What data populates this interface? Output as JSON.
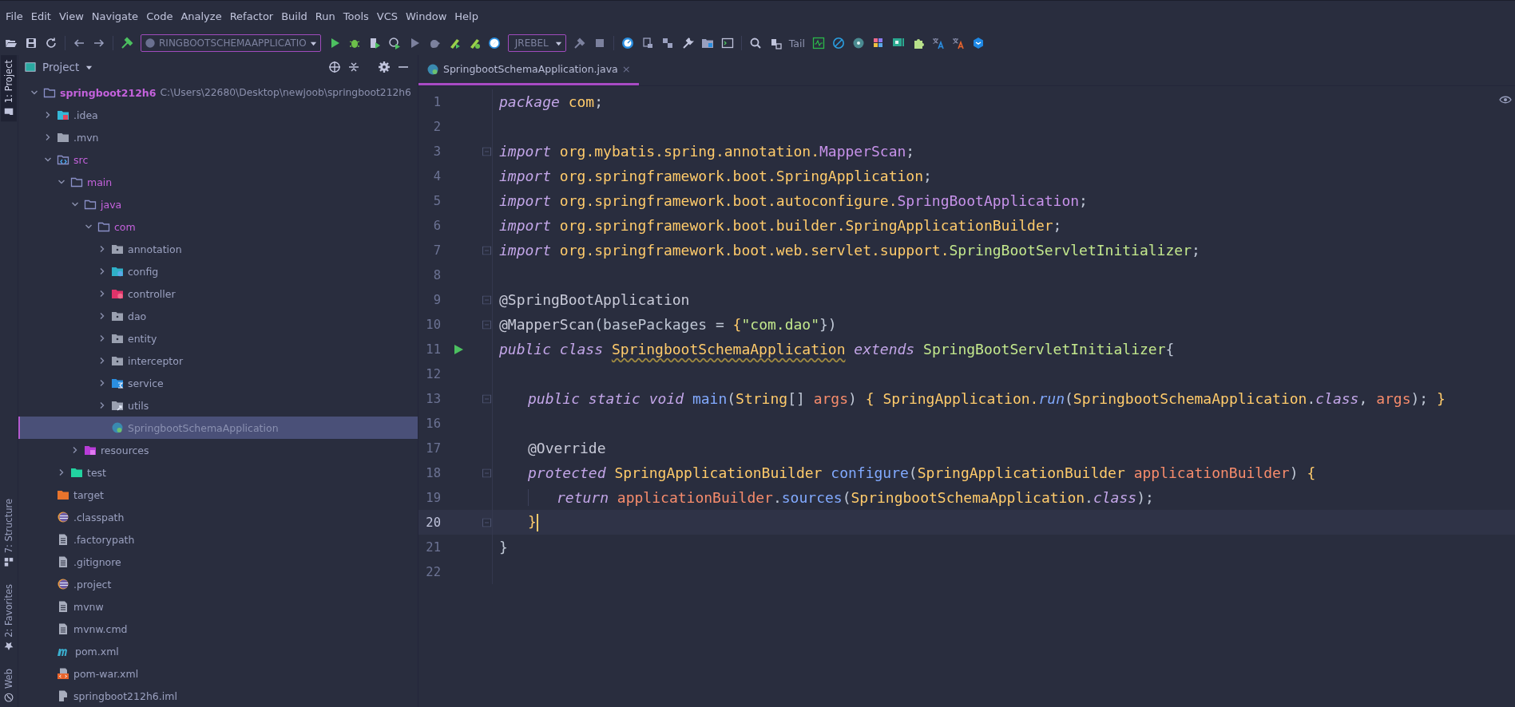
{
  "menu": [
    "File",
    "Edit",
    "View",
    "Navigate",
    "Code",
    "Analyze",
    "Refactor",
    "Build",
    "Run",
    "Tools",
    "VCS",
    "Window",
    "Help"
  ],
  "toolbar": {
    "run_config": "RINGBOOTSCHEMAAPPLICATIO",
    "jrebel": "JREBEL",
    "tail": "Tail"
  },
  "side_tabs_top": [
    {
      "label": "1: Project",
      "selected": true
    }
  ],
  "side_tabs_bottom": [
    {
      "label": "7: Structure",
      "selected": false
    },
    {
      "label": "2: Favorites",
      "selected": false
    },
    {
      "label": "Web",
      "selected": false
    }
  ],
  "project_panel": {
    "title": "Project",
    "tree": [
      {
        "name": "springboot212h6",
        "path": "C:\\Users\\22680\\Desktop\\newjoob\\springboot212h6",
        "kind": "module",
        "color": "#c462dc",
        "expanded": true,
        "selected": false,
        "children": [
          {
            "name": ".idea",
            "kind": "idea-folder",
            "color": "#9aa0bf",
            "expanded": false,
            "selected": false
          },
          {
            "name": ".mvn",
            "kind": "folder",
            "color": "#9aa0bf",
            "expanded": false,
            "selected": false
          },
          {
            "name": "src",
            "kind": "source-folder",
            "color": "#c462dc",
            "expanded": true,
            "selected": false,
            "children": [
              {
                "name": "main",
                "kind": "open-folder",
                "color": "#c462dc",
                "expanded": true,
                "selected": false,
                "children": [
                  {
                    "name": "java",
                    "kind": "open-folder",
                    "color": "#c462dc",
                    "expanded": true,
                    "selected": false,
                    "children": [
                      {
                        "name": "com",
                        "kind": "open-folder",
                        "color": "#c462dc",
                        "expanded": true,
                        "selected": false,
                        "children": [
                          {
                            "name": "annotation",
                            "kind": "package",
                            "color": "#9aa0bf",
                            "expanded": false,
                            "selected": false
                          },
                          {
                            "name": "config",
                            "kind": "config-package",
                            "color": "#9aa0bf",
                            "expanded": false,
                            "selected": false
                          },
                          {
                            "name": "controller",
                            "kind": "controller-package",
                            "color": "#9aa0bf",
                            "expanded": false,
                            "selected": false
                          },
                          {
                            "name": "dao",
                            "kind": "package",
                            "color": "#9aa0bf",
                            "expanded": false,
                            "selected": false
                          },
                          {
                            "name": "entity",
                            "kind": "package",
                            "color": "#9aa0bf",
                            "expanded": false,
                            "selected": false
                          },
                          {
                            "name": "interceptor",
                            "kind": "package",
                            "color": "#9aa0bf",
                            "expanded": false,
                            "selected": false
                          },
                          {
                            "name": "service",
                            "kind": "service-package",
                            "color": "#9aa0bf",
                            "expanded": false,
                            "selected": false
                          },
                          {
                            "name": "utils",
                            "kind": "utils-package",
                            "color": "#9aa0bf",
                            "expanded": false,
                            "selected": false
                          },
                          {
                            "name": "SpringbootSchemaApplication",
                            "kind": "spring-class",
                            "color": "#8a90b0",
                            "selected": true
                          }
                        ]
                      }
                    ]
                  },
                  {
                    "name": "resources",
                    "kind": "resources-folder",
                    "color": "#9aa0bf",
                    "expanded": false,
                    "selected": false
                  }
                ]
              },
              {
                "name": "test",
                "kind": "test-folder",
                "color": "#9aa0bf",
                "expanded": false,
                "selected": false
              }
            ]
          },
          {
            "name": "target",
            "kind": "excluded-folder",
            "color": "#9aa0bf",
            "selected": false
          },
          {
            "name": ".classpath",
            "kind": "eclipse-file",
            "color": "#9aa0bf",
            "selected": false
          },
          {
            "name": ".factorypath",
            "kind": "text-file",
            "color": "#9aa0bf",
            "selected": false
          },
          {
            "name": ".gitignore",
            "kind": "text-file",
            "color": "#9aa0bf",
            "selected": false
          },
          {
            "name": ".project",
            "kind": "eclipse-file",
            "color": "#9aa0bf",
            "selected": false
          },
          {
            "name": "mvnw",
            "kind": "text-file",
            "color": "#9aa0bf",
            "selected": false
          },
          {
            "name": "mvnw.cmd",
            "kind": "text-file",
            "color": "#9aa0bf",
            "selected": false
          },
          {
            "name": "pom.xml",
            "kind": "maven-file",
            "color": "#9aa0bf",
            "selected": false
          },
          {
            "name": "pom-war.xml",
            "kind": "xml-file",
            "color": "#9aa0bf",
            "selected": false
          },
          {
            "name": "springboot212h6.iml",
            "kind": "iml-file",
            "color": "#9aa0bf",
            "selected": false
          }
        ]
      }
    ]
  },
  "editor": {
    "tabs": [
      {
        "label": "SpringbootSchemaApplication.java",
        "selected": true,
        "close": "×"
      }
    ],
    "lines": [
      {
        "number": "1",
        "kind": "top",
        "tokens": [
          {
            "text": "package",
            "kind": "kw"
          },
          {
            "text": " com",
            "kind": "pkg"
          },
          {
            "text": ";",
            "kind": "p"
          }
        ]
      },
      {
        "number": "2"
      },
      {
        "number": "3",
        "kind": "top",
        "fold": true,
        "tokens": [
          {
            "text": "import",
            "kind": "kw"
          },
          {
            "text": " org.mybatis.spring.annotation.",
            "kind": "pkg"
          },
          {
            "text": "MapperScan",
            "kind": "type"
          },
          {
            "text": ";",
            "kind": "p"
          }
        ]
      },
      {
        "number": "4",
        "kind": "top",
        "tokens": [
          {
            "text": "import",
            "kind": "kw"
          },
          {
            "text": " org.springframework.boot.SpringApplication",
            "kind": "pkg"
          },
          {
            "text": ";",
            "kind": "p"
          }
        ]
      },
      {
        "number": "5",
        "kind": "top",
        "tokens": [
          {
            "text": "import",
            "kind": "kw"
          },
          {
            "text": " org.springframework.boot.autoconfigure.",
            "kind": "pkg"
          },
          {
            "text": "SpringBootApplication",
            "kind": "type"
          },
          {
            "text": ";",
            "kind": "p"
          }
        ]
      },
      {
        "number": "6",
        "kind": "top",
        "tokens": [
          {
            "text": "import",
            "kind": "kw"
          },
          {
            "text": " org.springframework.boot.builder.SpringApplicationBuilder",
            "kind": "pkg"
          },
          {
            "text": ";",
            "kind": "p"
          }
        ]
      },
      {
        "number": "7",
        "kind": "top",
        "fold": true,
        "tokens": [
          {
            "text": "import",
            "kind": "kw"
          },
          {
            "text": " org.springframework.boot.web.servlet.support.",
            "kind": "pkg"
          },
          {
            "text": "SpringBootServletInitializer",
            "kind": "green"
          },
          {
            "text": ";",
            "kind": "p"
          }
        ]
      },
      {
        "number": "8"
      },
      {
        "number": "9",
        "kind": "top",
        "fold": true,
        "tokens": [
          {
            "text": "@SpringBootApplication",
            "kind": "ann"
          }
        ]
      },
      {
        "number": "10",
        "kind": "top",
        "fold": true,
        "tokens": [
          {
            "text": "@MapperScan",
            "kind": "ann"
          },
          {
            "text": "(basePackages = ",
            "kind": "p"
          },
          {
            "text": "{",
            "kind": "pkg"
          },
          {
            "text": "\"com.dao\"",
            "kind": "str"
          },
          {
            "text": "})",
            "kind": "p"
          }
        ]
      },
      {
        "number": "11",
        "kind": "top",
        "run": true,
        "tokens": [
          {
            "text": "public class ",
            "kind": "kw"
          },
          {
            "text": "SpringbootSchemaApplication",
            "kind": "decl"
          },
          {
            "text": " extends ",
            "kind": "kw"
          },
          {
            "text": "SpringBootServletInitializer",
            "kind": "green"
          },
          {
            "text": "{",
            "kind": "p"
          }
        ]
      },
      {
        "number": "12"
      },
      {
        "number": "13",
        "kind": "member",
        "fold": true,
        "tokens": [
          {
            "text": "public static void ",
            "kind": "kw"
          },
          {
            "text": "main",
            "kind": "fn"
          },
          {
            "text": "(",
            "kind": "p"
          },
          {
            "text": "String",
            "kind": "pkg"
          },
          {
            "text": "[] ",
            "kind": "p"
          },
          {
            "text": "args",
            "kind": "param"
          },
          {
            "text": ") ",
            "kind": "p"
          },
          {
            "text": "{ SpringApplication.",
            "kind": "pkg"
          },
          {
            "text": "run",
            "kind": "fnit"
          },
          {
            "text": "(",
            "kind": "p"
          },
          {
            "text": "SpringbootSchemaApplication",
            "kind": "pkg"
          },
          {
            "text": ".",
            "kind": "p"
          },
          {
            "text": "class",
            "kind": "kw"
          },
          {
            "text": ", ",
            "kind": "p"
          },
          {
            "text": "args",
            "kind": "param"
          },
          {
            "text": "); ",
            "kind": "p"
          },
          {
            "text": "}",
            "kind": "pkg"
          }
        ]
      },
      {
        "number": "16"
      },
      {
        "number": "17",
        "kind": "member",
        "tokens": [
          {
            "text": "@Override",
            "kind": "ann"
          }
        ]
      },
      {
        "number": "18",
        "kind": "member",
        "fold": true,
        "tokens": [
          {
            "text": "protected ",
            "kind": "kw"
          },
          {
            "text": "SpringApplicationBuilder ",
            "kind": "pkg"
          },
          {
            "text": "configure",
            "kind": "fn"
          },
          {
            "text": "(",
            "kind": "p"
          },
          {
            "text": "SpringApplicationBuilder ",
            "kind": "pkg"
          },
          {
            "text": "applicationBuilder",
            "kind": "param"
          },
          {
            "text": ") ",
            "kind": "p"
          },
          {
            "text": "{",
            "kind": "pkg"
          }
        ]
      },
      {
        "number": "19",
        "kind": "statement",
        "tokens": [
          {
            "text": "return ",
            "kind": "kw"
          },
          {
            "text": "applicationBuilder",
            "kind": "param"
          },
          {
            "text": ".",
            "kind": "p"
          },
          {
            "text": "sources",
            "kind": "fn"
          },
          {
            "text": "(",
            "kind": "p"
          },
          {
            "text": "SpringbootSchemaApplication",
            "kind": "pkg"
          },
          {
            "text": ".",
            "kind": "p"
          },
          {
            "text": "class",
            "kind": "kw"
          },
          {
            "text": ");",
            "kind": "p"
          }
        ]
      },
      {
        "number": "20",
        "kind": "member",
        "fold": true,
        "current": true,
        "tokens": [
          {
            "text": "}",
            "kind": "pkg"
          }
        ]
      },
      {
        "number": "21",
        "kind": "top",
        "tokens": [
          {
            "text": "}",
            "kind": "p"
          }
        ]
      },
      {
        "number": "22"
      }
    ]
  }
}
